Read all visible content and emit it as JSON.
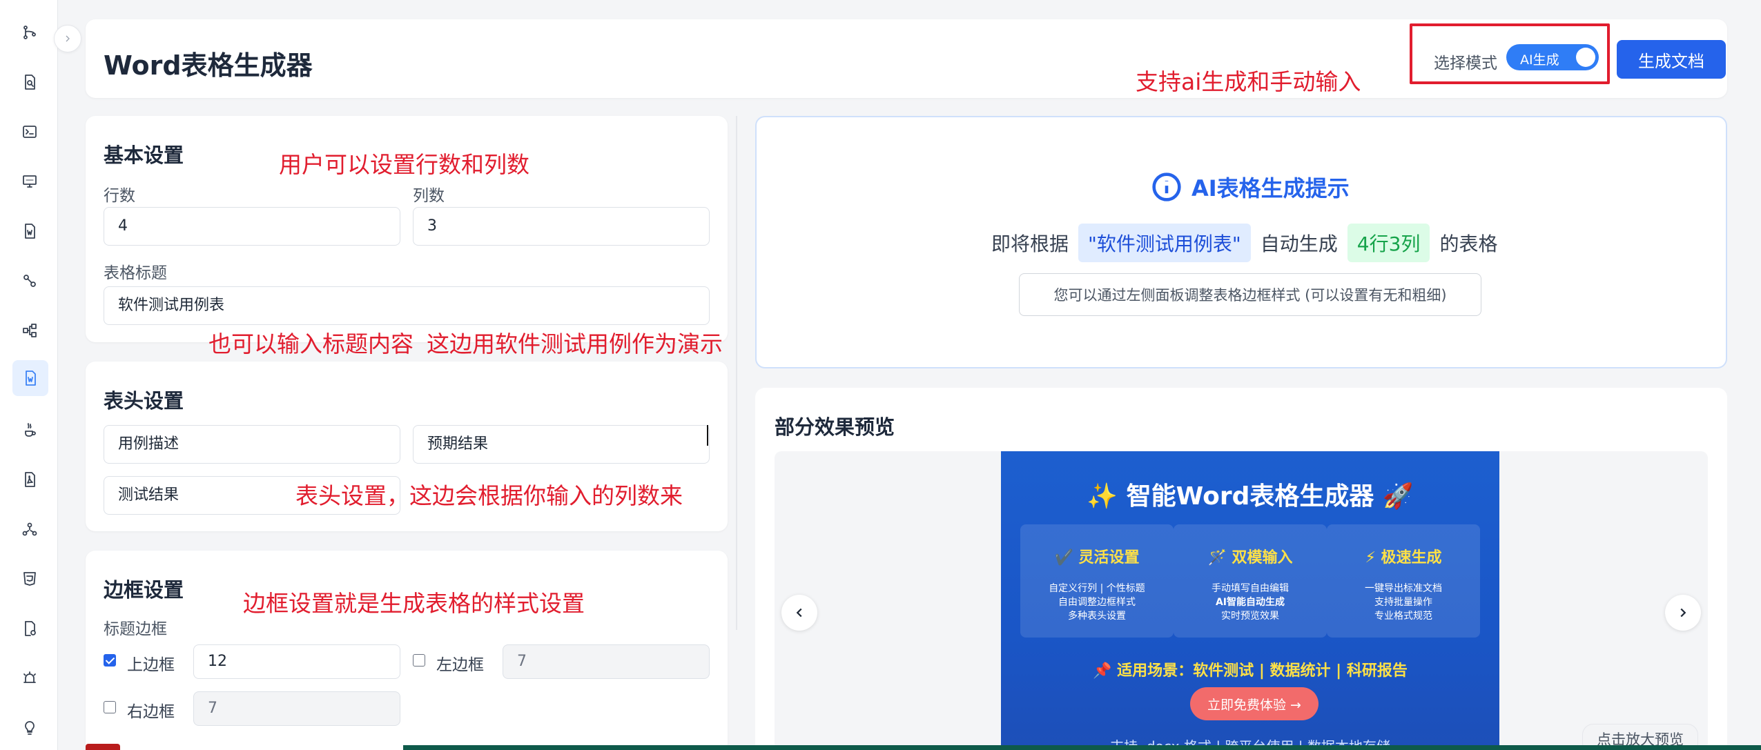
{
  "app": {
    "title": "Word表格生成器"
  },
  "header": {
    "mode_label": "选择模式",
    "mode_toggle_text": "AI生成",
    "mode_toggle_on": true,
    "generate_button": "生成文档"
  },
  "annotations": {
    "mode": "支持ai生成和手动输入",
    "rows_cols": "用户可以设置行数和列数",
    "title_input": "也可以输入标题内容",
    "demo": "这边用软件测试用例作为演示",
    "headers": "表头设置，这边会根据你输入的列数来",
    "border": "边框设置就是生成表格的样式设置"
  },
  "basic_settings": {
    "title": "基本设置",
    "rows_label": "行数",
    "rows_value": "4",
    "cols_label": "列数",
    "cols_value": "3",
    "table_title_label": "表格标题",
    "table_title_value": "软件测试用例表"
  },
  "header_settings": {
    "title": "表头设置",
    "headers": [
      "用例描述",
      "预期结果",
      "测试结果"
    ]
  },
  "border_settings": {
    "title": "边框设置",
    "subtitle": "标题边框",
    "top": {
      "label": "上边框",
      "checked": true,
      "value": "12"
    },
    "left": {
      "label": "左边框",
      "checked": false,
      "value": "7"
    },
    "right": {
      "label": "右边框",
      "checked": false,
      "value": "7"
    }
  },
  "ai_hint": {
    "title": "AI表格生成提示",
    "prefix": "即将根据",
    "title_chip": "\"软件测试用例表\"",
    "middle": "自动生成",
    "size_chip": "4行3列",
    "suffix": "的表格",
    "note": "您可以通过左侧面板调整表格边框样式 (可以设置有无和粗细)"
  },
  "preview": {
    "title": "部分效果预览",
    "zoom_hint": "点击放大预览",
    "banner": {
      "title": "✨ 智能Word表格生成器 🚀",
      "features": [
        {
          "title": "✔️ 灵活设置",
          "lines": [
            "自定义行列 | 个性标题",
            "自由调整边框样式",
            "多种表头设置"
          ]
        },
        {
          "title": "🪄 双模输入",
          "lines": [
            "手动填写自由编辑",
            "AI智能自动生成",
            "实时预览效果"
          ]
        },
        {
          "title": "⚡ 极速生成",
          "lines": [
            "一键导出标准文档",
            "支持批量操作",
            "专业格式规范"
          ]
        }
      ],
      "scenario": "📌 适用场景：软件测试 | 数据统计 | 科研报告",
      "cta": "立即免费体验 →",
      "footer_cut": "支持 .docx 格式 | 跨平台使用 | 数据本地存储"
    }
  },
  "colors": {
    "primary": "#2563eb",
    "annotation_red": "#e11d2e",
    "banner_blue": "#1a56c7",
    "highlight_yellow": "#fde047"
  }
}
